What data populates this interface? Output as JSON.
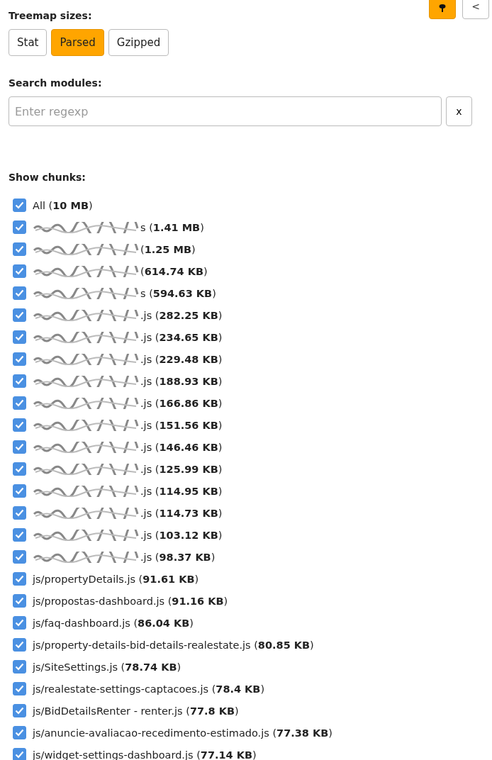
{
  "top_buttons": [
    {
      "kind": "pin",
      "selected": true
    },
    {
      "kind": "collapse",
      "label": "<",
      "selected": false
    }
  ],
  "treemap_sizes": {
    "title": "Treemap sizes:",
    "options": [
      {
        "label": "Stat",
        "selected": false
      },
      {
        "label": "Parsed",
        "selected": true
      },
      {
        "label": "Gzipped",
        "selected": false
      }
    ]
  },
  "search": {
    "title": "Search modules:",
    "placeholder": "Enter regexp",
    "clear_label": "x"
  },
  "chunks": {
    "title": "Show chunks:",
    "items": [
      {
        "label": "All (**10 MB**)",
        "redacted": false,
        "checked": true
      },
      {
        "label": "s (**1.41 MB**)",
        "redacted": true,
        "checked": true
      },
      {
        "label": "(**1.25 MB**)",
        "redacted": true,
        "checked": true
      },
      {
        "label": "(**614.74 KB**)",
        "redacted": true,
        "checked": true
      },
      {
        "label": "s (**594.63 KB**)",
        "redacted": true,
        "checked": true
      },
      {
        "label": ".js (**282.25 KB**)",
        "redacted": true,
        "checked": true
      },
      {
        "label": ".js (**234.65 KB**)",
        "redacted": true,
        "checked": true
      },
      {
        "label": ".js (**229.48 KB**)",
        "redacted": true,
        "checked": true
      },
      {
        "label": ".js (**188.93 KB**)",
        "redacted": true,
        "checked": true
      },
      {
        "label": ".js (**166.86 KB**)",
        "redacted": true,
        "checked": true
      },
      {
        "label": ".js (**151.56 KB**)",
        "redacted": true,
        "checked": true
      },
      {
        "label": ".js (**146.46 KB**)",
        "redacted": true,
        "checked": true
      },
      {
        "label": ".js (**125.99 KB**)",
        "redacted": true,
        "checked": true
      },
      {
        "label": ".js (**114.95 KB**)",
        "redacted": true,
        "checked": true
      },
      {
        "label": ".js (**114.73 KB**)",
        "redacted": true,
        "checked": true
      },
      {
        "label": ".js (**103.12 KB**)",
        "redacted": true,
        "checked": true
      },
      {
        "label": ".js (**98.37 KB**)",
        "redacted": true,
        "checked": true
      },
      {
        "label": "js/propertyDetails.js (**91.61 KB**)",
        "redacted": false,
        "checked": true
      },
      {
        "label": "js/propostas-dashboard.js (**91.16 KB**)",
        "redacted": false,
        "checked": true
      },
      {
        "label": "js/faq-dashboard.js (**86.04 KB**)",
        "redacted": false,
        "checked": true
      },
      {
        "label": "js/property-details-bid-details-realestate.js (**80.85 KB**)",
        "redacted": false,
        "checked": true
      },
      {
        "label": "js/SiteSettings.js (**78.74 KB**)",
        "redacted": false,
        "checked": true
      },
      {
        "label": "js/realestate-settings-captacoes.js (**78.4 KB**)",
        "redacted": false,
        "checked": true
      },
      {
        "label": "js/BidDetailsRenter - renter.js (**77.8 KB**)",
        "redacted": false,
        "checked": true
      },
      {
        "label": "js/anuncie-avaliacao-recedimento-estimado.js (**77.38 KB**)",
        "redacted": false,
        "checked": true
      },
      {
        "label": "js/widget-settings-dashboard.js (**77.14 KB**)",
        "redacted": false,
        "checked": true
      }
    ]
  }
}
